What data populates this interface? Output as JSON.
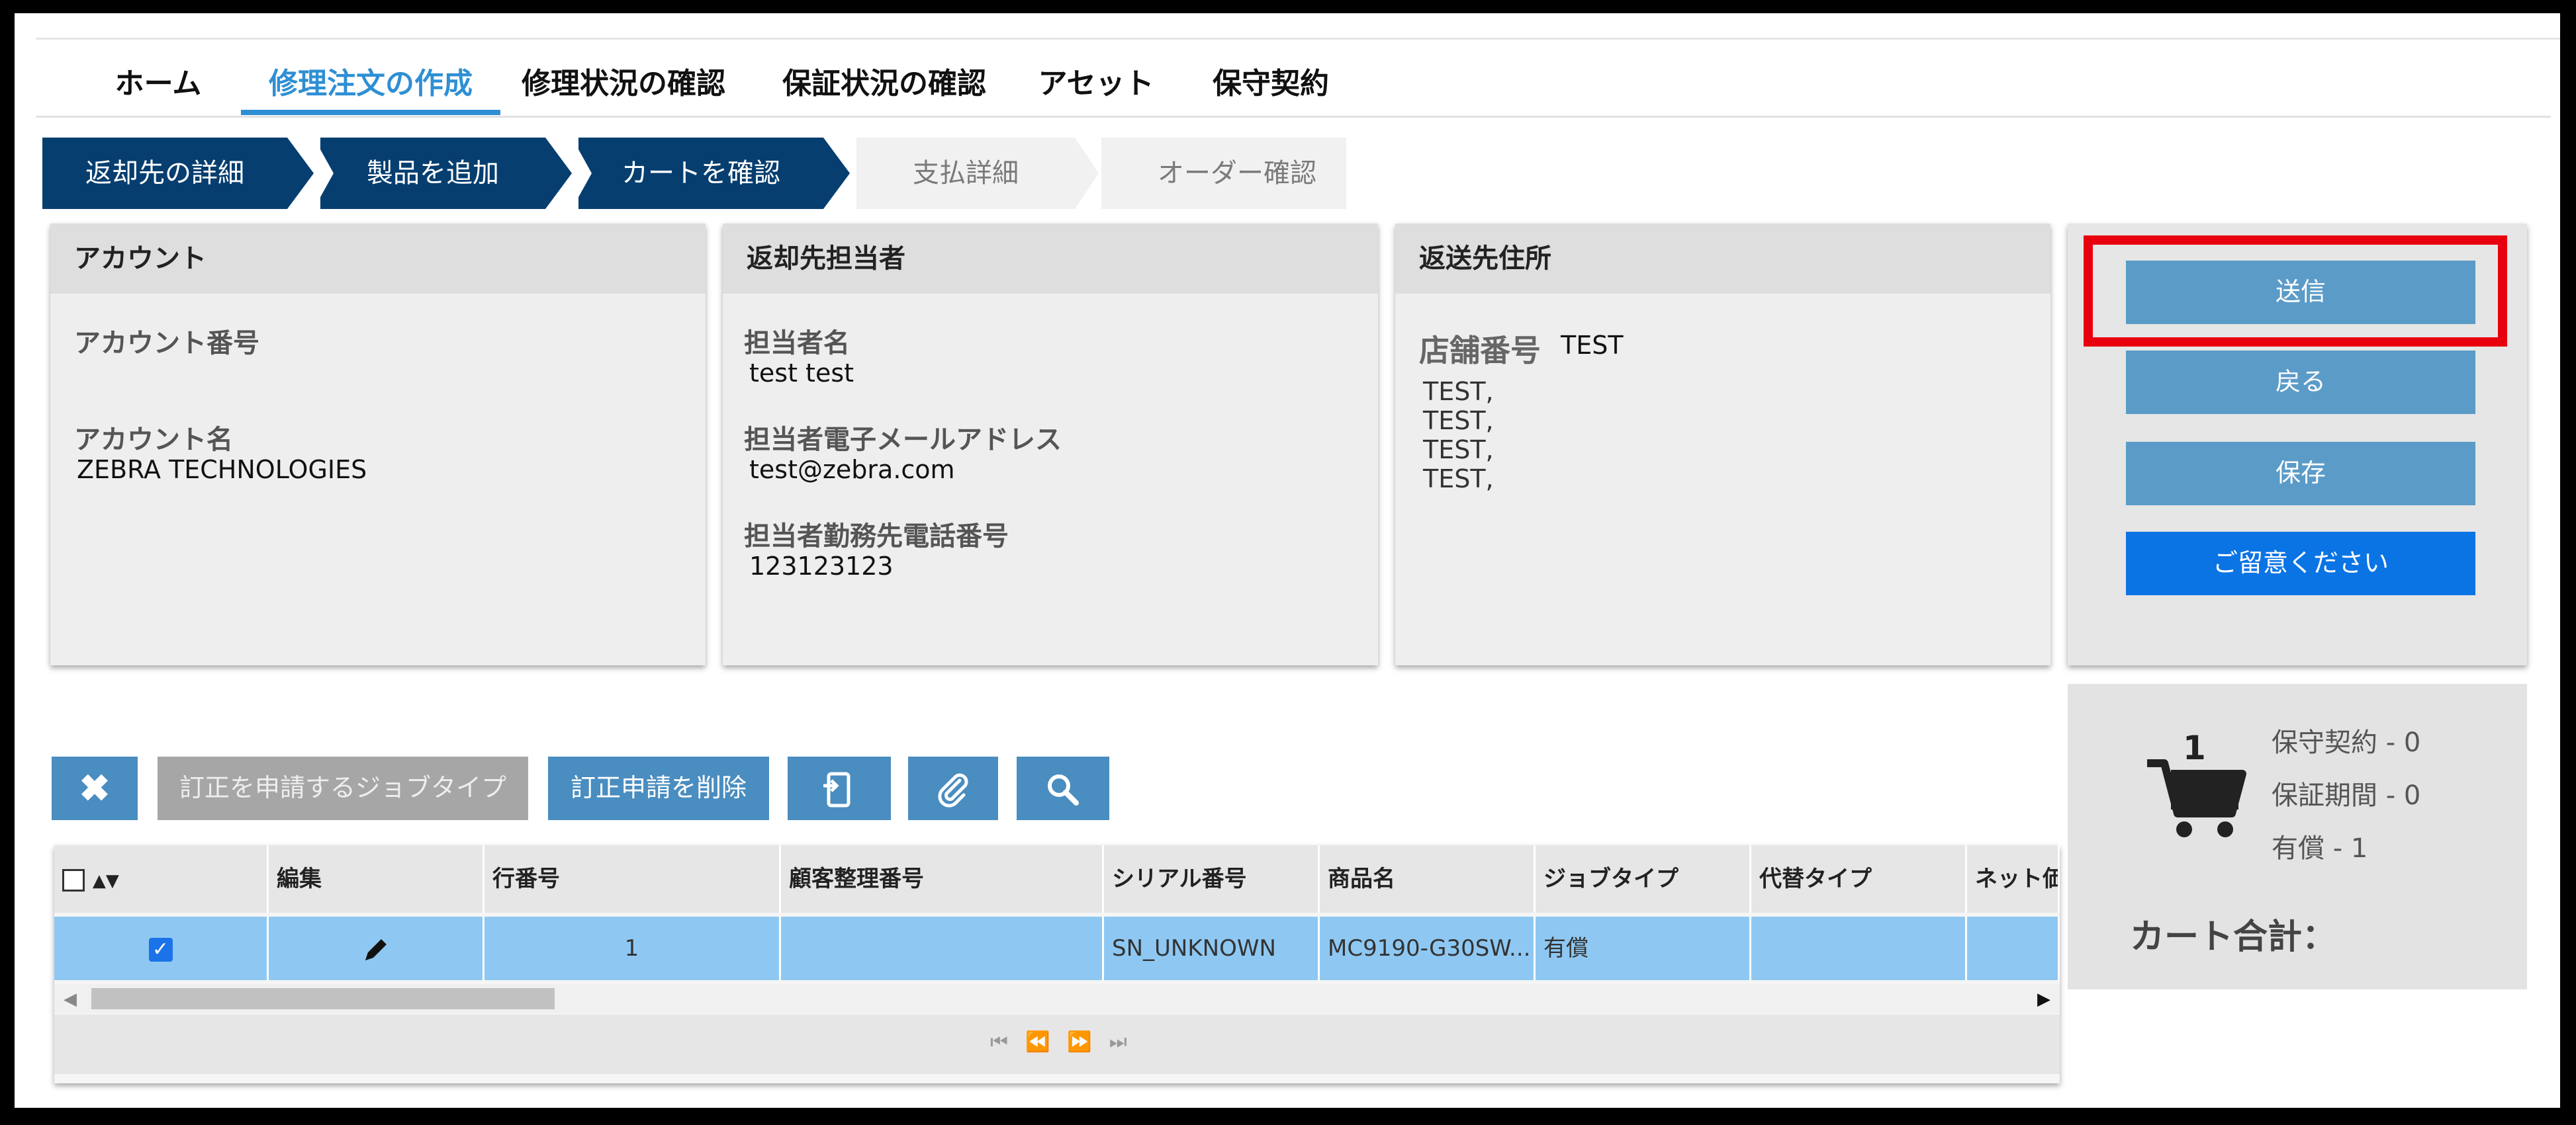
{
  "nav": {
    "tabs": [
      {
        "label": "ホーム"
      },
      {
        "label": "修理注文の作成",
        "active": true
      },
      {
        "label": "修理状況の確認"
      },
      {
        "label": "保証状況の確認"
      },
      {
        "label": "アセット"
      },
      {
        "label": "保守契約"
      }
    ]
  },
  "steps": [
    {
      "label": "返却先の詳細",
      "state": "done"
    },
    {
      "label": "製品を追加",
      "state": "done"
    },
    {
      "label": "カートを確認",
      "state": "done"
    },
    {
      "label": "支払詳細",
      "state": "pending"
    },
    {
      "label": "オーダー確認",
      "state": "pending"
    }
  ],
  "account": {
    "header": "アカウント",
    "number_label": "アカウント番号",
    "number_value": "",
    "name_label": "アカウント名",
    "name_value": "ZEBRA TECHNOLOGIES"
  },
  "contact": {
    "header": "返却先担当者",
    "name_label": "担当者名",
    "name_value": "test test",
    "email_label": "担当者電子メールアドレス",
    "email_value": "test@zebra.com",
    "phone_label": "担当者勤務先電話番号",
    "phone_value": "123123123"
  },
  "address": {
    "header": "返送先住所",
    "store_label": "店舗番号",
    "store_value": "TEST",
    "lines": [
      "TEST,",
      "TEST,",
      "TEST,",
      "TEST,"
    ]
  },
  "actions": {
    "submit": "送信",
    "back": "戻る",
    "save": "保存",
    "notice": "ご留意ください"
  },
  "cart": {
    "count": "1",
    "maintenance": "保守契約 - 0",
    "warranty": "保証期間 - 0",
    "paid": "有償 - 1",
    "total_label": "カート合計："
  },
  "toolbar": {
    "request_jobtype": "訂正を申請するジョブタイプ",
    "delete_request": "訂正申請を削除"
  },
  "grid": {
    "headers": [
      "▲▼",
      "編集",
      "行番号",
      "顧客整理番号",
      "シリアル番号",
      "商品名",
      "ジョブタイプ",
      "代替タイプ",
      "ネット価"
    ],
    "row": {
      "checked": true,
      "line_no": "1",
      "customer_ref": "",
      "serial": "SN_UNKNOWN",
      "product": "MC9190-G30SW...",
      "job_type": "有償",
      "replacement_type": "",
      "net_price": ""
    }
  },
  "colors": {
    "accent": "#2e8fd4",
    "step_done": "#063e6f",
    "button": "#5b9bc8",
    "primary": "#0b74e4",
    "highlight": "#e8000f",
    "row_selected": "#8ec8f2"
  }
}
